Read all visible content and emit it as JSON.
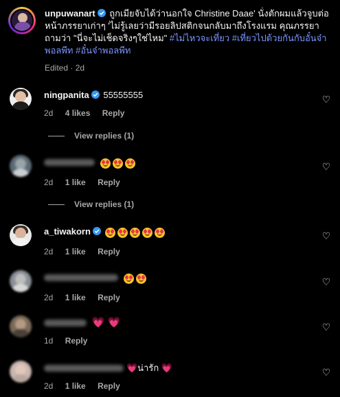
{
  "post": {
    "username": "unpuwanart",
    "caption_text": "ถูกเมียจับได้ว่านอกใจ Christine Daae' นั่งตักผมแล้วจูบต่อหน้าภรรยาเก่าๆ 'ไม่รู้เลยว่ามีรอยลิปสติกจนกลับมาถึงโรงแรม คุณภรรยาถามว่า \"นี่จะไม่เช็ดจริงๆใช่ไหม\"",
    "hashtags": "#ไม่ไหวจะเที่ยว #เที่ยวไปด้วยกันกับอั๋นจ๋าพอลพีท #อั๋นจ๋าพอลพีท",
    "edited_label": "Edited",
    "edited_time": "2d"
  },
  "comments": [
    {
      "username": "ningpanita",
      "verified": true,
      "text": "55555555",
      "time": "2d",
      "likes": "4 likes",
      "reply": "Reply",
      "view_replies": "View replies (1)"
    },
    {
      "username": "",
      "verified": false,
      "emoji_count": 3,
      "time": "2d",
      "likes": "1 like",
      "reply": "Reply",
      "view_replies": "View replies (1)"
    },
    {
      "username": "a_tiwakorn",
      "verified": true,
      "emoji_count": 5,
      "time": "2d",
      "likes": "1 like",
      "reply": "Reply"
    },
    {
      "username": "",
      "verified": false,
      "emoji_count": 2,
      "time": "2d",
      "likes": "1 like",
      "reply": "Reply"
    },
    {
      "username": "",
      "verified": false,
      "text": "💗 💗",
      "time": "1d",
      "reply": "Reply"
    },
    {
      "username": "",
      "verified": false,
      "text": "💗น่ารัก 💗",
      "time": "2d",
      "likes": "1 like",
      "reply": "Reply"
    }
  ],
  "icons": {
    "like": "heart-outline-icon",
    "verified": "verified-badge-icon"
  },
  "colors": {
    "background": "#000000",
    "hashtag": "#7b95ff",
    "verified": "#3897f0",
    "secondary_text": "#a8a8a8"
  }
}
